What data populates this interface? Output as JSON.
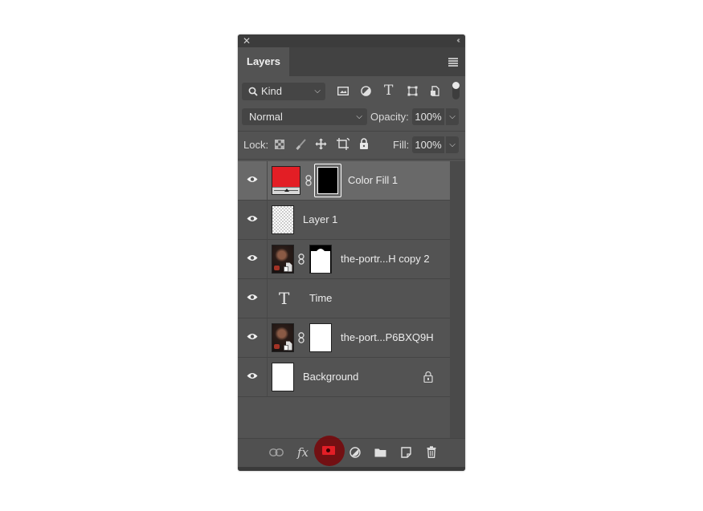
{
  "panel": {
    "close_glyph": "✕",
    "collapse_glyph": "‹‹",
    "tab_label": "Layers",
    "menu_icon": "panel-menu-icon"
  },
  "filter": {
    "kind_label": "Kind",
    "kind_chevron": "⌵",
    "icons": [
      "image-filter-icon",
      "adjustment-filter-icon",
      "type-filter-icon",
      "shape-filter-icon",
      "smart-object-filter-icon"
    ],
    "type_glyph": "T"
  },
  "blend": {
    "mode": "Normal",
    "opacity_label": "Opacity:",
    "opacity_value": "100%"
  },
  "lock": {
    "label": "Lock:",
    "fill_label": "Fill:",
    "fill_value": "100%",
    "icons": [
      "lock-transparent-icon",
      "lock-image-icon",
      "lock-position-icon",
      "lock-artboard-icon",
      "lock-all-icon"
    ]
  },
  "layers": [
    {
      "name": "Color Fill 1",
      "type": "fill",
      "selected": true,
      "fill_color": "#e31e25"
    },
    {
      "name": "Layer 1",
      "type": "pixel",
      "selected": false
    },
    {
      "name": "the-portr...H copy 2",
      "type": "smart-masked",
      "selected": false
    },
    {
      "name": "Time",
      "type": "text",
      "selected": false,
      "glyph": "T"
    },
    {
      "name": "the-port...P6BXQ9H",
      "type": "smart-masked",
      "selected": false
    },
    {
      "name": "Background",
      "type": "background",
      "selected": false,
      "locked": true
    }
  ],
  "bottom_bar": {
    "fx_label": "fx",
    "buttons": [
      "link-layers-button",
      "add-style-button",
      "add-mask-button",
      "new-adjustment-button",
      "new-group-button",
      "new-layer-button",
      "delete-layer-button"
    ],
    "highlighted": "add-mask-button",
    "highlight_color": "#7a0508"
  }
}
